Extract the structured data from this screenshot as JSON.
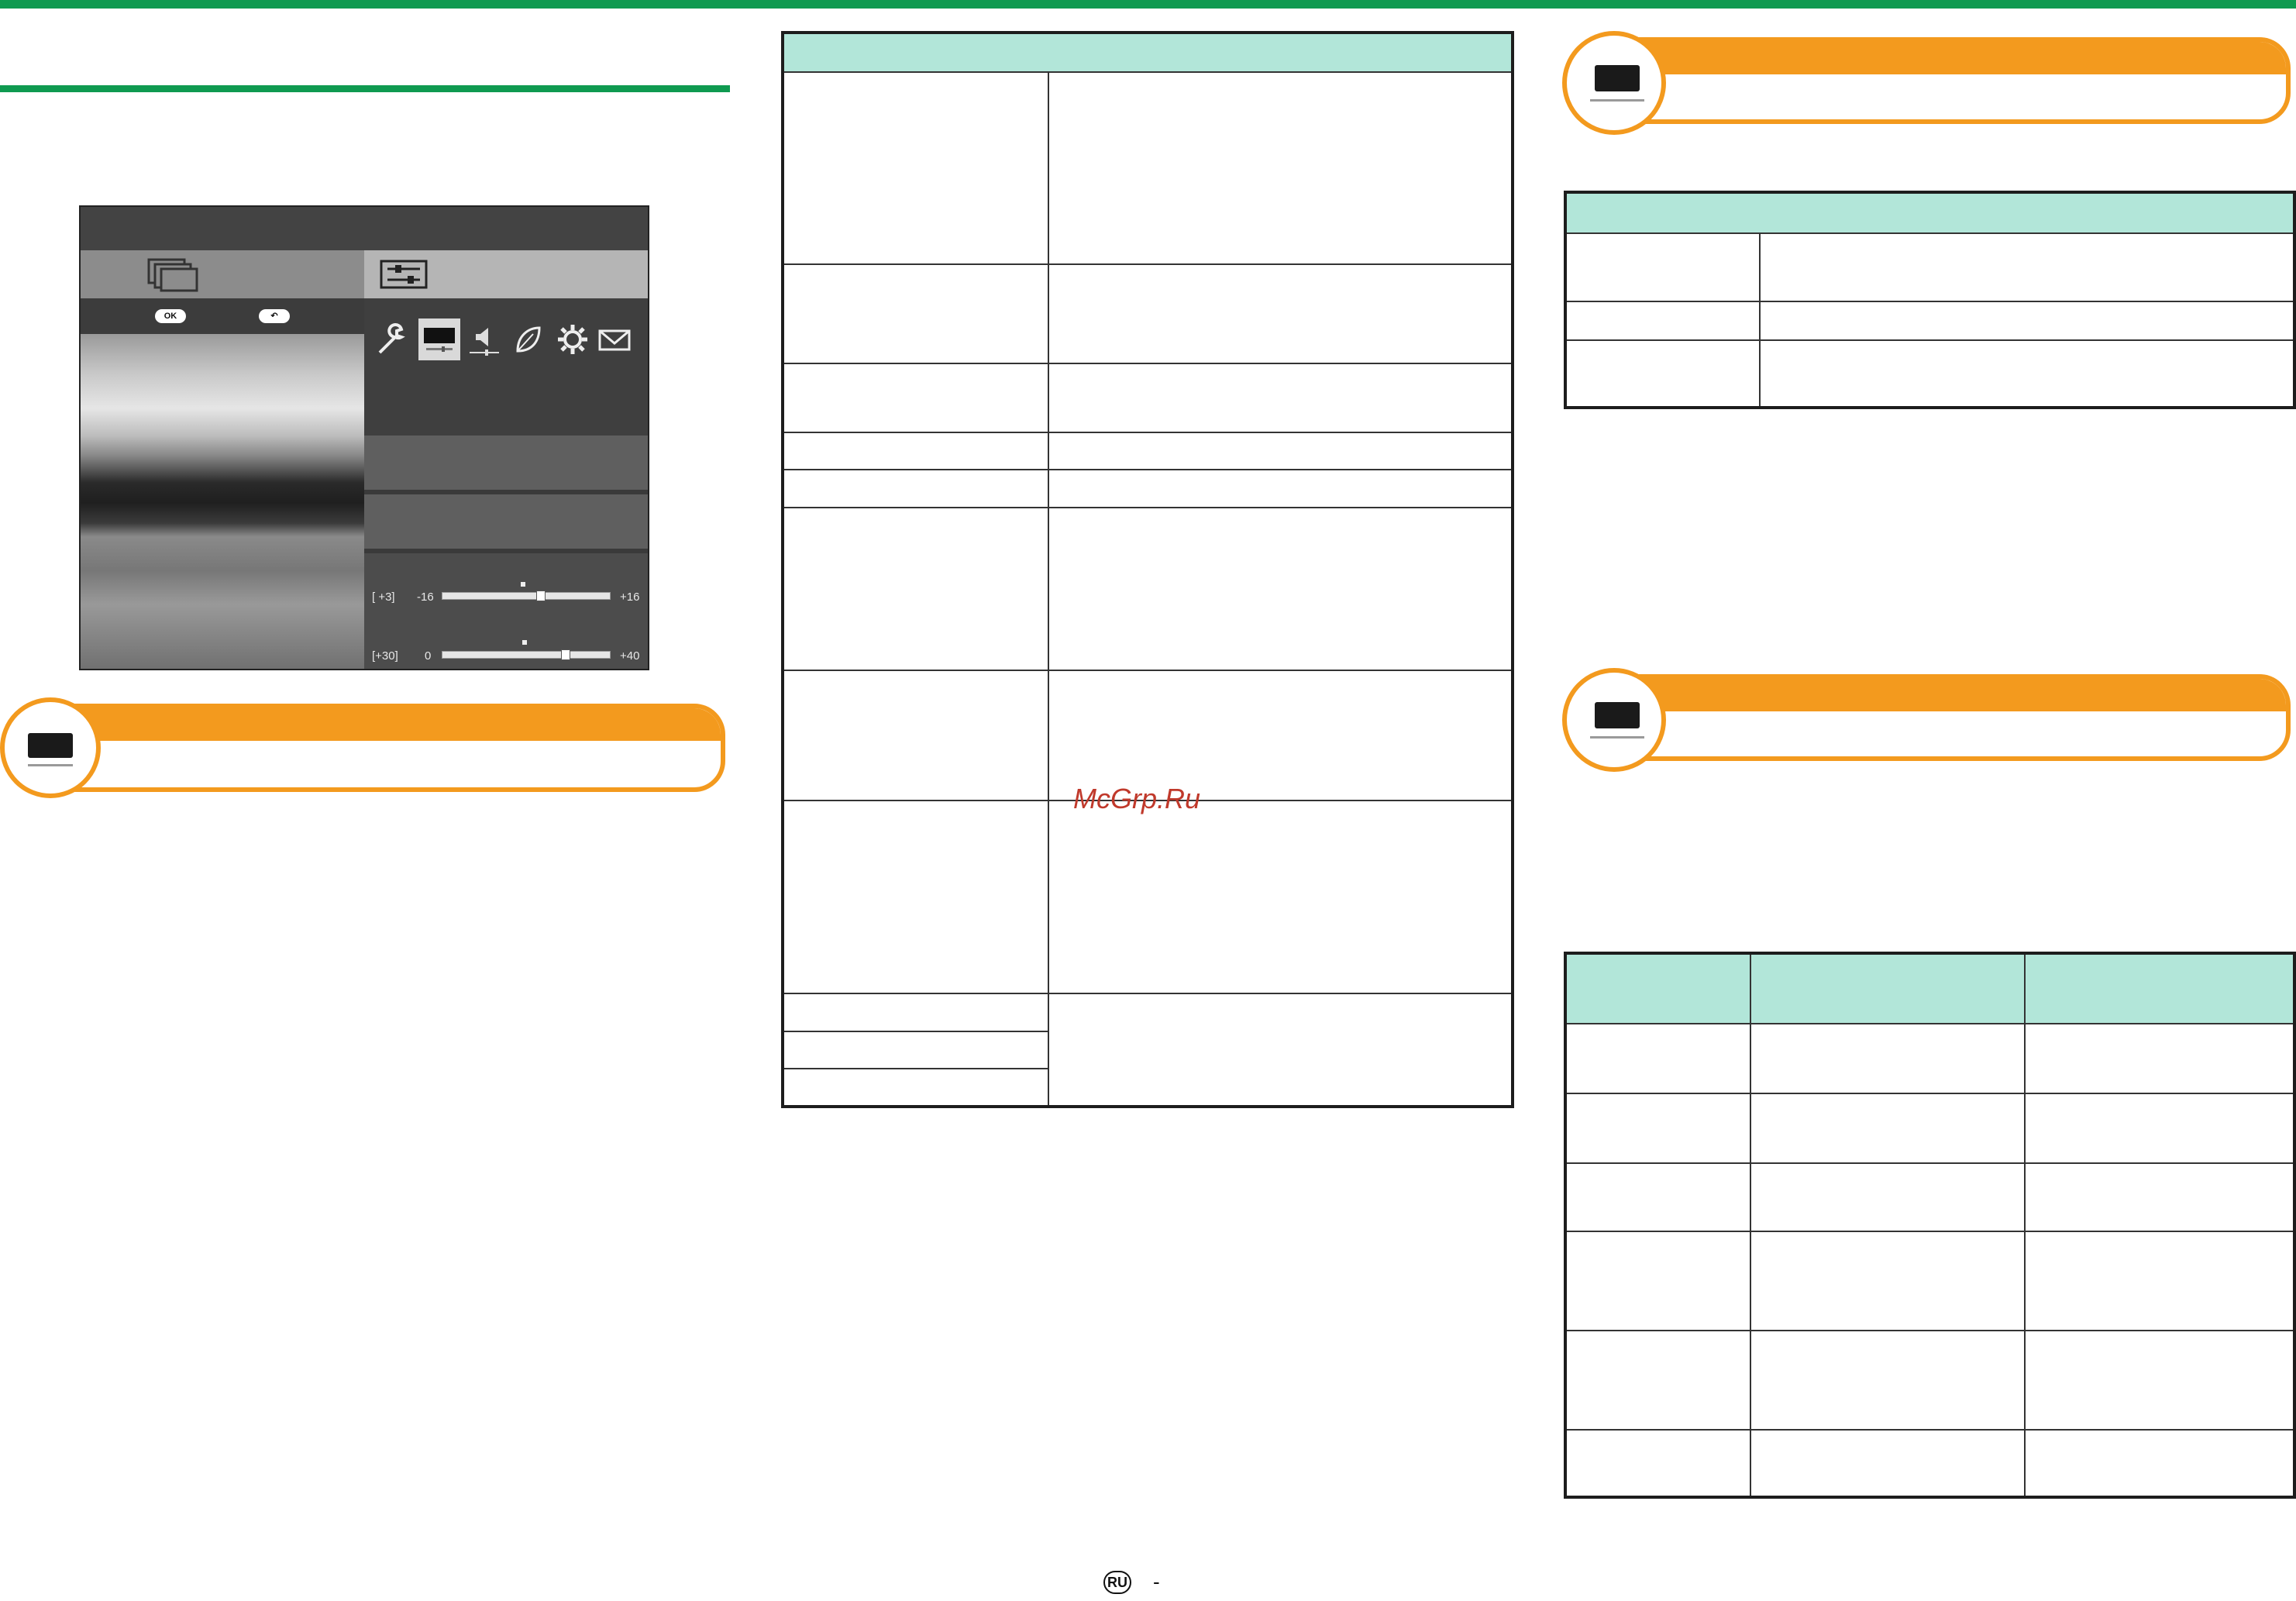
{
  "tv_menu": {
    "ok_button": "OK",
    "back_button": "↶",
    "slider1": {
      "bracket_value": "[  +3]",
      "min": "-16",
      "max": "+16",
      "value": 3,
      "range": [
        -16,
        16
      ]
    },
    "slider2": {
      "bracket_value": "[+30]",
      "min": "0",
      "max": "+40",
      "value": 30,
      "range": [
        0,
        40
      ]
    },
    "icons": [
      "wrench-icon",
      "picture-icon",
      "speaker-icon",
      "leaf-icon",
      "gear-icon",
      "envelope-icon"
    ]
  },
  "watermark": "McGrp.Ru",
  "footer": {
    "page_badge": "RU",
    "dash": "-"
  },
  "colors": {
    "green": "#0f9a50",
    "orange": "#f39a1e",
    "teal": "#b2e6d9"
  }
}
